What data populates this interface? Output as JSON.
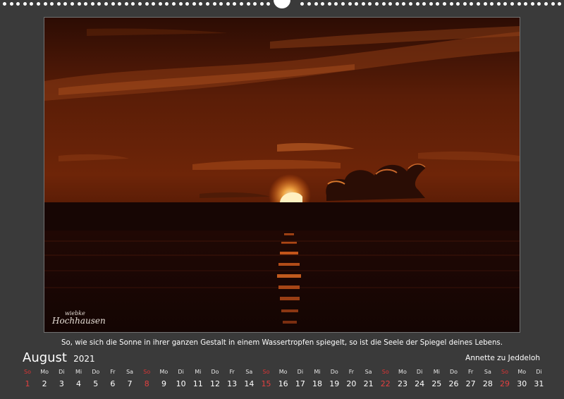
{
  "page": {
    "background_color": "#3a3a3a",
    "accent_sunday_color": "#e24040"
  },
  "photo": {
    "subject": "sunset over the sea",
    "signature_line1": "wiebke",
    "signature_line2": "Hochhausen"
  },
  "caption": "So, wie sich die Sonne in ihrer ganzen Gestalt in einem Wassertropfen spiegelt, so ist die Seele der Spiegel deines Lebens.",
  "calendar": {
    "month": "August",
    "year": "2021",
    "author": "Annette zu Jeddeloh",
    "weekdays": [
      "So",
      "Mo",
      "Di",
      "Mi",
      "Do",
      "Fr",
      "Sa",
      "So",
      "Mo",
      "Di",
      "Mi",
      "Do",
      "Fr",
      "Sa",
      "So",
      "Mo",
      "Di",
      "Mi",
      "Do",
      "Fr",
      "Sa",
      "So",
      "Mo",
      "Di",
      "Mi",
      "Do",
      "Fr",
      "Sa",
      "So",
      "Mo",
      "Di"
    ],
    "days": [
      "1",
      "2",
      "3",
      "4",
      "5",
      "6",
      "7",
      "8",
      "9",
      "10",
      "11",
      "12",
      "13",
      "14",
      "15",
      "16",
      "17",
      "18",
      "19",
      "20",
      "21",
      "22",
      "23",
      "24",
      "25",
      "26",
      "27",
      "28",
      "29",
      "30",
      "31"
    ],
    "sunday_indices": [
      0,
      7,
      14,
      21,
      28
    ]
  }
}
